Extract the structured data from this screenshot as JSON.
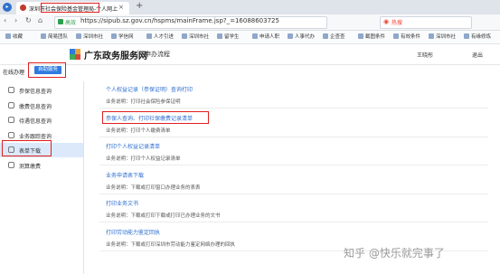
{
  "browser": {
    "tab_title": "深圳市社会保险基金管理局-个人网上",
    "tab_close": "×",
    "new_tab": "+",
    "nav_icon": "▸",
    "back": "‹",
    "forward": "›",
    "reload": "↻",
    "home": "⌂",
    "secure_label": "高效",
    "url": "https://sipub.sz.gov.cn/hspms/mainFrame.jsp?_=16088603725",
    "search_hot": "热搜"
  },
  "bookmarks": [
    "收藏",
    "简易团队",
    "深圳市社",
    "学信网",
    "人才引进",
    "深圳市社",
    "留学生",
    "申请人职",
    "人事代办",
    "企查查",
    "截图条件",
    "有效条件",
    "深圳市社",
    "有缘修炼"
  ],
  "site": {
    "title": "广东政务服务网",
    "subtitle": "申办流程",
    "user": "王晓彤",
    "logout": "退出"
  },
  "section_tabs": {
    "online": "在线办理",
    "self_service": "自助服务"
  },
  "sidebar": {
    "items": [
      {
        "label": "参保信息查询",
        "icon": "user-info-icon"
      },
      {
        "label": "缴费信息查询",
        "icon": "payment-icon"
      },
      {
        "label": "待遇信息查询",
        "icon": "benefit-icon"
      },
      {
        "label": "业务跟踪查询",
        "icon": "tracking-icon"
      },
      {
        "label": "表单下载",
        "icon": "download-icon"
      },
      {
        "label": "测算缴费",
        "icon": "calculator-icon"
      }
    ]
  },
  "main": {
    "sections": [
      {
        "title": "个人权益记录（参保证明）查询打印",
        "desc": "业务说明：打印社会保险参保证明"
      },
      {
        "title": "参保人查询、打印社保缴费记录清单",
        "desc": "业务说明：打印个人缴费清单"
      },
      {
        "title": "打印个人权益记录清单",
        "desc": "业务说明：打印个人权益记录清单"
      },
      {
        "title": "业务申请表下载",
        "desc": "业务说明：下载或打印窗口办理业务的表表"
      },
      {
        "title": "打印业务文书",
        "desc": "业务说明：下载或打印下载或打印已办理业务的文书"
      },
      {
        "title": "打印劳动能力鉴定回执",
        "desc": "业务说明：下载或打印深圳市劳动能力鉴定网络办理的回执"
      }
    ]
  },
  "watermark": "知乎 @快乐就完事了"
}
